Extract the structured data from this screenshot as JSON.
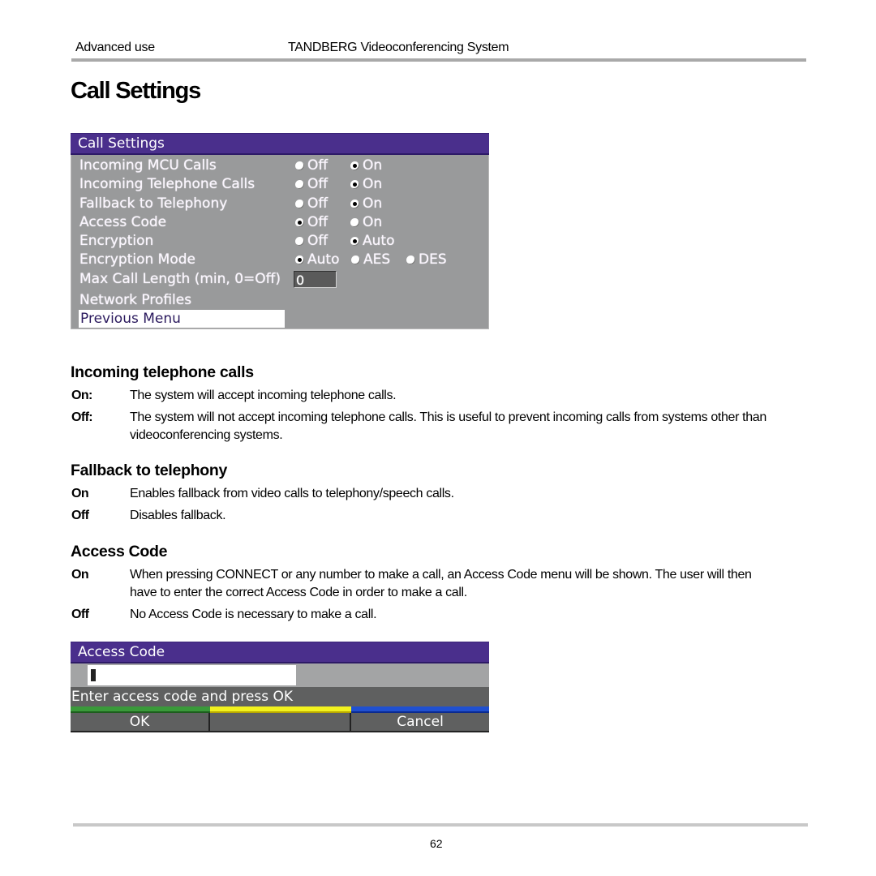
{
  "header": {
    "section": "Advanced use",
    "product": "TANDBERG Videoconferencing System"
  },
  "page_title": "Call Settings",
  "call_settings_menu": {
    "title": "Call Settings",
    "title_color": "#4a2f8c",
    "rows": [
      {
        "label": "Incoming MCU Calls",
        "options": [
          {
            "label": "Off",
            "selected": false
          },
          {
            "label": "On",
            "selected": true
          }
        ]
      },
      {
        "label": "Incoming Telephone Calls",
        "options": [
          {
            "label": "Off",
            "selected": false
          },
          {
            "label": "On",
            "selected": true
          }
        ]
      },
      {
        "label": "Fallback to Telephony",
        "options": [
          {
            "label": "Off",
            "selected": false
          },
          {
            "label": "On",
            "selected": true
          }
        ]
      },
      {
        "label": "Access Code",
        "options": [
          {
            "label": "Off",
            "selected": true
          },
          {
            "label": "On",
            "selected": false
          }
        ]
      },
      {
        "label": "Encryption",
        "options": [
          {
            "label": "Off",
            "selected": false
          },
          {
            "label": "Auto",
            "selected": true
          }
        ]
      },
      {
        "label": "Encryption Mode",
        "options": [
          {
            "label": "Auto",
            "selected": true
          },
          {
            "label": "AES",
            "selected": false
          },
          {
            "label": "DES",
            "selected": false
          }
        ]
      }
    ],
    "max_call_length": {
      "label": "Max Call Length (min, 0=Off)",
      "value": "0"
    },
    "network_profiles": "Network Profiles",
    "previous_menu": "Previous Menu"
  },
  "sections": [
    {
      "heading": "Incoming telephone calls",
      "items": [
        {
          "term": "On:",
          "text": "The system will accept incoming telephone calls."
        },
        {
          "term": "Off:",
          "text": "The system will not accept incoming telephone calls. This is useful to prevent incoming calls from systems other than videoconferencing systems."
        }
      ]
    },
    {
      "heading": "Fallback to telephony",
      "items": [
        {
          "term": "On",
          "text": "Enables fallback from video calls to telephony/speech calls."
        },
        {
          "term": "Off",
          "text": "Disables fallback."
        }
      ]
    },
    {
      "heading": "Access Code",
      "items": [
        {
          "term": "On",
          "text": "When pressing CONNECT or any number to make a call, an Access Code menu will be shown. The user will then have to enter the correct Access Code in order to make a call."
        },
        {
          "term": "Off",
          "text": "No Access Code is necessary to make a call."
        }
      ]
    }
  ],
  "access_code_menu": {
    "title": "Access Code",
    "input_value": "",
    "prompt": "Enter access code and press OK",
    "buttons": [
      {
        "label": "OK",
        "color": "#3a9a3a"
      },
      {
        "label": "",
        "color": "#f2f21e"
      },
      {
        "label": "Cancel",
        "color": "#2050d0"
      }
    ]
  },
  "footer": {
    "page_number": "62"
  }
}
